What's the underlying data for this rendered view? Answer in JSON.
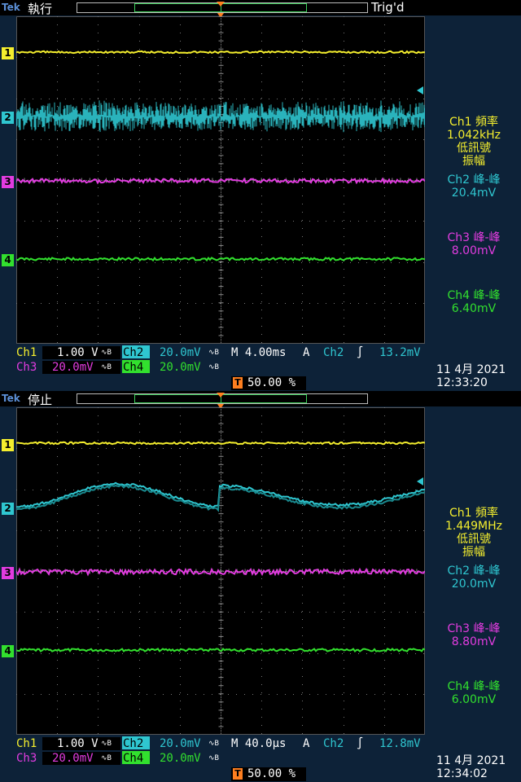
{
  "colors": {
    "ch1": "#f4ee2e",
    "ch2": "#2fc6d0",
    "ch3": "#e23ce0",
    "ch4": "#32e02e",
    "trigger": "#ff7f1f",
    "tek": "#5b8fd6"
  },
  "screens": [
    {
      "brand": "Tek",
      "run_state": "執行",
      "trigger_status": "Trig'd",
      "trigger_marker_label": "T",
      "channel_markers": [
        "1",
        "2",
        "3",
        "4"
      ],
      "measurements": [
        {
          "line1": "Ch1 頻率",
          "line2": "1.042kHz",
          "line3": "低訊號",
          "line4": "振幅"
        },
        {
          "line1": "Ch2 峰-峰",
          "line2": "20.4mV"
        },
        {
          "line1": "Ch3 峰-峰",
          "line2": "8.00mV"
        },
        {
          "line1": "Ch4 峰-峰",
          "line2": "6.40mV"
        }
      ],
      "status": {
        "ch1_label": "Ch1",
        "ch1_scale": "1.00 V",
        "ch1_bw": "∿B",
        "ch2_label": "Ch2",
        "ch2_scale": "20.0mV",
        "ch2_bw": "∿B",
        "timebase": "M 4.00ms",
        "trig_mode": "A",
        "trig_src": "Ch2",
        "trig_slope": "∫",
        "trig_level": "13.2mV",
        "ch3_label": "Ch3",
        "ch3_scale": "20.0mV",
        "ch3_bw": "∿B",
        "ch4_label": "Ch4",
        "ch4_scale": "20.0mV",
        "ch4_bw": "∿B"
      },
      "trigger_position": "50.00 %",
      "date": "11 4月  2021",
      "time": "12:33:20",
      "ch2_waveform": "noise"
    },
    {
      "brand": "Tek",
      "run_state": "停止",
      "trigger_status": "",
      "trigger_marker_label": "T",
      "channel_markers": [
        "1",
        "2",
        "3",
        "4"
      ],
      "measurements": [
        {
          "line1": "Ch1 頻率",
          "line2": "1.449MHz",
          "line3": "低訊號",
          "line4": "振幅"
        },
        {
          "line1": "Ch2 峰-峰",
          "line2": "20.0mV"
        },
        {
          "line1": "Ch3 峰-峰",
          "line2": "8.80mV"
        },
        {
          "line1": "Ch4 峰-峰",
          "line2": "6.00mV"
        }
      ],
      "status": {
        "ch1_label": "Ch1",
        "ch1_scale": "1.00 V",
        "ch1_bw": "∿B",
        "ch2_label": "Ch2",
        "ch2_scale": "20.0mV",
        "ch2_bw": "∿B",
        "timebase": "M 40.0µs",
        "trig_mode": "A",
        "trig_src": "Ch2",
        "trig_slope": "∫",
        "trig_level": "12.8mV",
        "ch3_label": "Ch3",
        "ch3_scale": "20.0mV",
        "ch3_bw": "∿B",
        "ch4_label": "Ch4",
        "ch4_scale": "20.0mV",
        "ch4_bw": "∿B"
      },
      "trigger_position": "50.00 %",
      "date": "11 4月  2021",
      "time": "12:34:02",
      "ch2_waveform": "sine"
    }
  ]
}
